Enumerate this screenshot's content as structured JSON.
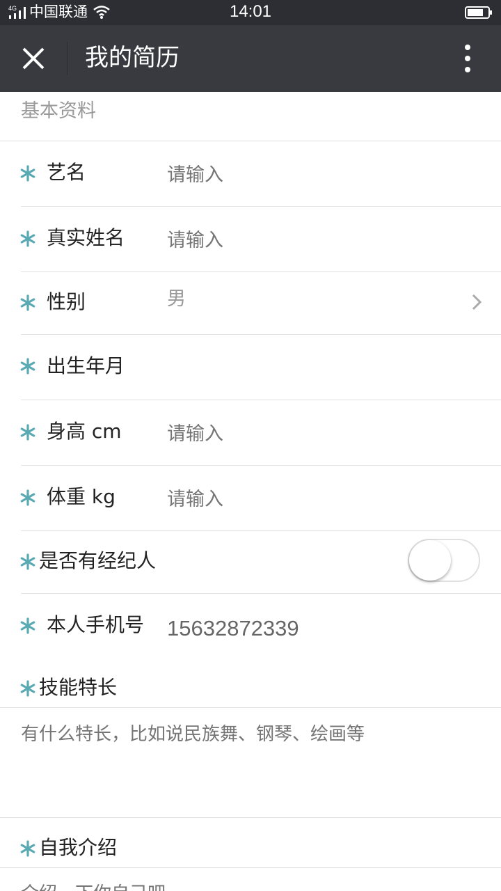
{
  "status_bar": {
    "network": "4G",
    "carrier": "中国联通",
    "time": "14:01",
    "icons": [
      "signal-icon",
      "wifi-icon",
      "battery-icon"
    ]
  },
  "nav": {
    "title": "我的简历",
    "icons": [
      "close-icon",
      "more-vertical-icon"
    ]
  },
  "section": {
    "title": "基本资料"
  },
  "colors": {
    "accent_asterisk": "#5aaab3",
    "nav_bg": "#393a3f",
    "status_bg": "#2c2e33"
  },
  "form": {
    "stage_name": {
      "label": "艺名",
      "placeholder": "请输入"
    },
    "real_name": {
      "label": "真实姓名",
      "placeholder": "请输入"
    },
    "gender": {
      "label": "性别",
      "value": "男"
    },
    "birth": {
      "label": "出生年月"
    },
    "height": {
      "label": "身高 cm",
      "placeholder": "请输入"
    },
    "weight": {
      "label": "体重 kg",
      "placeholder": "请输入"
    },
    "agent": {
      "label": "是否有经纪人",
      "enabled": false
    },
    "phone": {
      "label": "本人手机号",
      "value": "15632872339"
    },
    "skills": {
      "label": "技能特长",
      "placeholder": "有什么特长，比如说民族舞、钢琴、绘画等"
    },
    "intro": {
      "label": "自我介绍",
      "placeholder": "介绍一下你自己吧"
    }
  }
}
